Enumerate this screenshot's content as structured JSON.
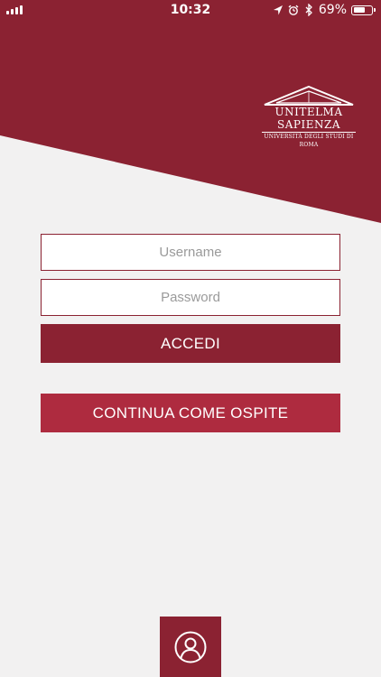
{
  "status_bar": {
    "time": "10:32",
    "battery_percent": "69%",
    "battery_level": 0.69,
    "icons": [
      "signal-icon",
      "location-icon",
      "alarm-icon",
      "bluetooth-icon",
      "battery-icon"
    ]
  },
  "brand": {
    "name": "UNITELMA SAPIENZA",
    "subtitle": "UNIVERSITÀ DEGLI STUDI DI ROMA"
  },
  "login_form": {
    "username_placeholder": "Username",
    "password_placeholder": "Password",
    "login_label": "ACCEDI",
    "guest_label": "CONTINUA COME OSPITE"
  },
  "bottom_tab": {
    "icon": "user-profile-icon"
  },
  "colors": {
    "primary": "#8b2232",
    "secondary": "#ae2b3f",
    "background": "#f2f1f1",
    "text_on_primary": "#ffffff",
    "placeholder": "#9a9a9a"
  }
}
